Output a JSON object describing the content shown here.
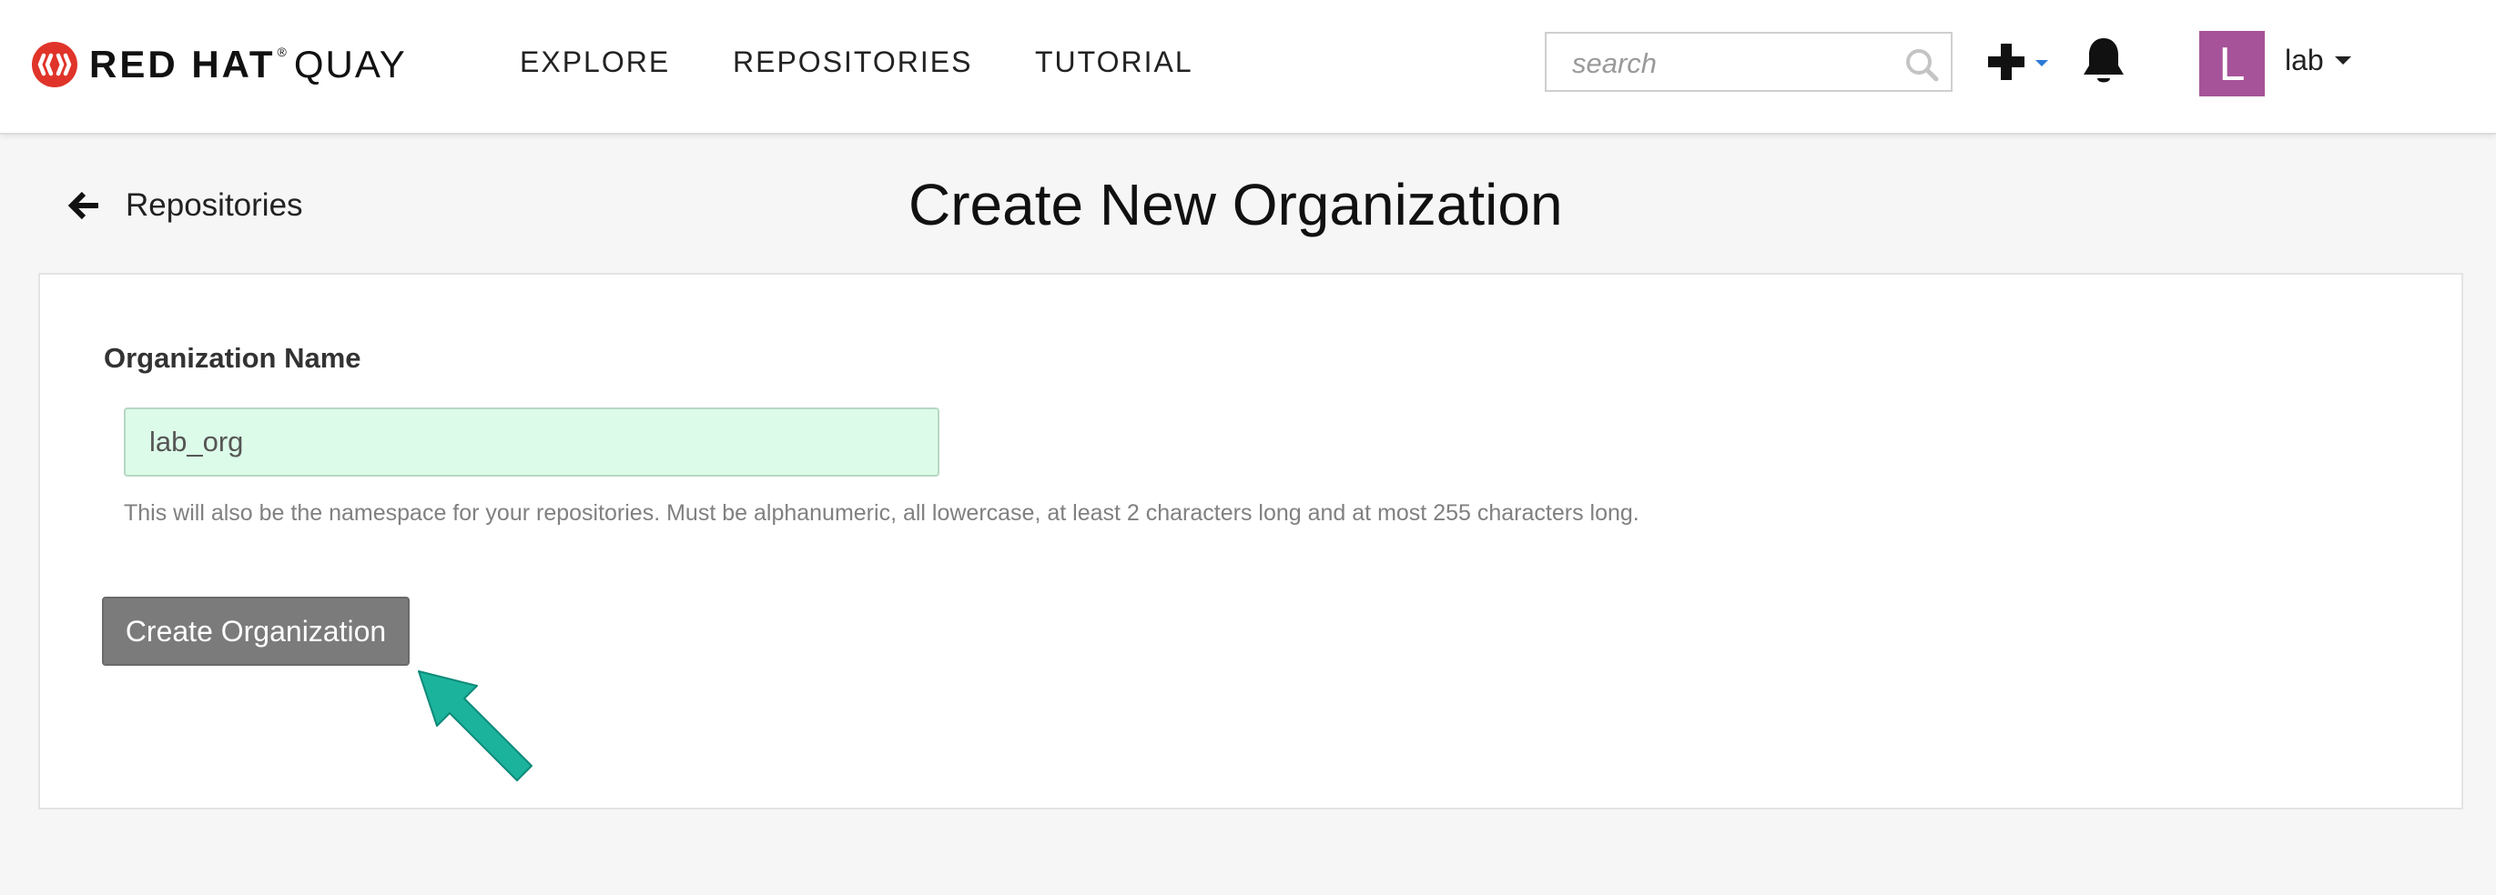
{
  "navbar": {
    "brand_text": "RED HAT",
    "brand_reg": "®",
    "brand_product": "QUAY",
    "links": [
      {
        "label": "EXPLORE"
      },
      {
        "label": "REPOSITORIES"
      },
      {
        "label": "TUTORIAL"
      }
    ],
    "search": {
      "placeholder": "search",
      "value": ""
    },
    "icons": {
      "search": "search-icon",
      "plus": "plus-icon",
      "notifications": "bell-icon",
      "logo": "red-hat-logo"
    },
    "user": {
      "avatar_letter": "L",
      "name": "lab",
      "avatar_color": "#a65399"
    }
  },
  "header": {
    "back_label": "Repositories",
    "title": "Create New Organization"
  },
  "form": {
    "label": "Organization Name",
    "value": "lab_org",
    "help": "This will also be the namespace for your repositories. Must be alphanumeric, all lowercase, at least 2 characters long and at most 255 characters long.",
    "submit_label": "Create Organization"
  },
  "colors": {
    "accent_arrow": "#1bb39c",
    "input_valid_bg": "#dcfbe9",
    "button_bg": "#7b7b7b",
    "brand_red": "#e0342a"
  }
}
